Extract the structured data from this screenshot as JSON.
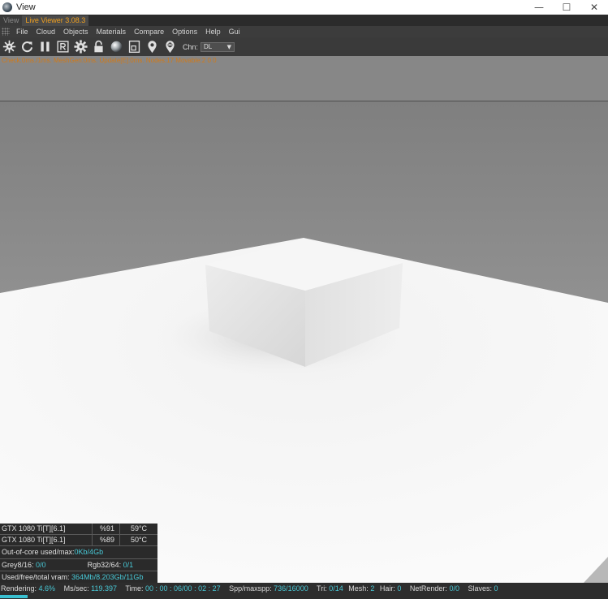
{
  "window": {
    "title": "View",
    "controls": {
      "minimize": "—",
      "maximize": "☐",
      "close": "✕"
    }
  },
  "tabs": [
    {
      "label": "View",
      "active": false
    },
    {
      "label": "Live Viewer 3.08.3",
      "active": true
    }
  ],
  "menu": [
    "File",
    "Cloud",
    "Objects",
    "Materials",
    "Compare",
    "Options",
    "Help",
    "Gui"
  ],
  "toolbar": {
    "buttons": [
      "settings-gear-icon",
      "refresh-icon",
      "pause-icon",
      "render-region-icon",
      "gear-icon",
      "lock-icon",
      "material-sphere-icon",
      "viewport-frame-icon",
      "pick-focus-icon",
      "pick-material-icon"
    ],
    "channel_label": "Chn:",
    "channel_value": "DL"
  },
  "stats_line": "Check:0ms./1ms. MeshGen:0ms. Update[E]:0ms. Nodes:17 Movable:2  0 0",
  "gpus": [
    {
      "name": "GTX 1080 Ti[T][6.1]",
      "util": "%91",
      "temp": "59°C"
    },
    {
      "name": "GTX 1080 Ti[T][6.1]",
      "util": "%89",
      "temp": "50°C"
    }
  ],
  "out_of_core": {
    "label": "Out-of-core used/max:",
    "value": "0Kb/4Gb"
  },
  "textures": {
    "grey_label": "Grey8/16:",
    "grey_value": "0/0",
    "rgb_label": "Rgb32/64:",
    "rgb_value": "0/1"
  },
  "vram": {
    "label": "Used/free/total vram:",
    "value": "364Mb/8.203Gb/11Gb"
  },
  "status": {
    "rendering_label": "Rendering:",
    "rendering_value": "4.6%",
    "ms_label": "Ms/sec:",
    "ms_value": "119.397",
    "time_label": "Time:",
    "time_value": "00 : 00 : 06/00 : 02 : 27",
    "spp_label": "Spp/maxspp:",
    "spp_value": "736/16000",
    "tri_label": "Tri:",
    "tri_value": "0/14",
    "mesh_label": "Mesh:",
    "mesh_value": "2",
    "hair_label": "Hair:",
    "hair_value": "0",
    "netrender_label": "NetRender:",
    "netrender_value": "0/0",
    "slaves_label": "Slaves:",
    "slaves_value": "0"
  },
  "render_progress": 0.046,
  "colors": {
    "accent": "#f0a020",
    "highlight": "#48c9d7",
    "stats_text": "#d07a1a"
  }
}
